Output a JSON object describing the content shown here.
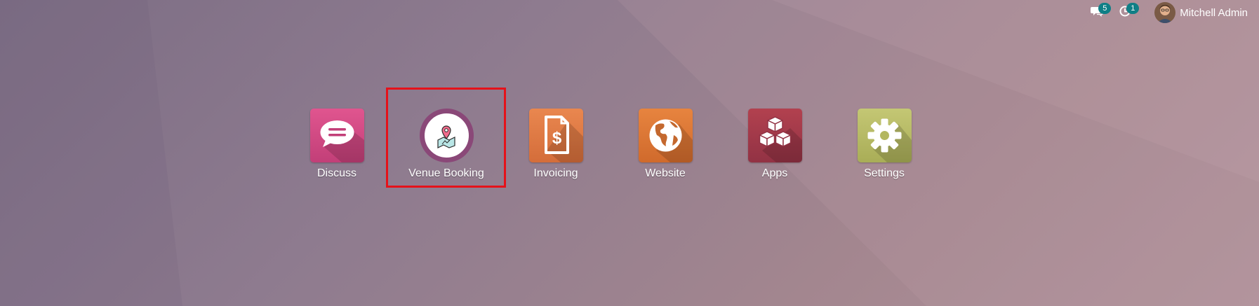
{
  "topbar": {
    "messages_badge": "5",
    "activities_badge": "1",
    "user_name": "Mitchell Admin"
  },
  "apps": [
    {
      "name": "discuss",
      "label": "Discuss",
      "icon": "chat-bubble-icon",
      "color": "#d24c86"
    },
    {
      "name": "venue-booking",
      "label": "Venue Booking",
      "icon": "map-pin-icon",
      "color": "#8a4878"
    },
    {
      "name": "invoicing",
      "label": "Invoicing",
      "icon": "invoice-dollar-icon",
      "color": "#e07c44"
    },
    {
      "name": "website",
      "label": "Website",
      "icon": "globe-icon",
      "color": "#e0773a"
    },
    {
      "name": "apps",
      "label": "Apps",
      "icon": "cubes-icon",
      "color": "#a23a4c"
    },
    {
      "name": "settings",
      "label": "Settings",
      "icon": "gear-icon",
      "color": "#b8bb63"
    }
  ],
  "highlight_color": "#e5121a"
}
